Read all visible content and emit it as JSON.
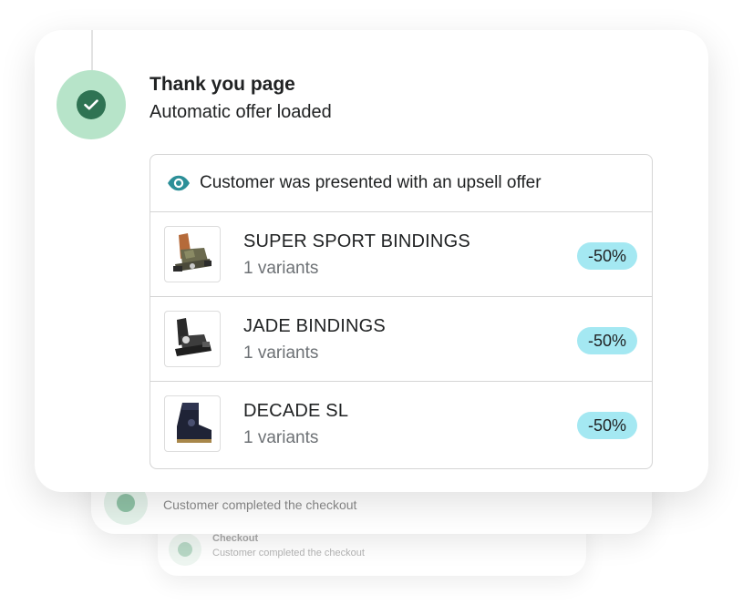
{
  "main_card": {
    "title": "Thank you page",
    "subtitle": "Automatic offer loaded",
    "offer": {
      "header": "Customer was presented with an upsell offer",
      "header_icon": "eye-icon",
      "products": [
        {
          "name": "SUPER SPORT BINDINGS",
          "variants": "1 variants",
          "discount": "-50%",
          "image": "snowboard-binding-camo"
        },
        {
          "name": "JADE BINDINGS",
          "variants": "1 variants",
          "discount": "-50%",
          "image": "snowboard-binding-black"
        },
        {
          "name": "DECADE SL",
          "variants": "1 variants",
          "discount": "-50%",
          "image": "snowboard-boot"
        }
      ]
    }
  },
  "back_card_1": {
    "text": "Customer completed the checkout"
  },
  "back_card_2": {
    "title": "Checkout",
    "text": "Customer completed the checkout"
  },
  "colors": {
    "status_circle_outer": "#b7e4c9",
    "status_circle_inner": "#2f7353",
    "discount_badge": "#a4e8f2",
    "eye_icon": "#2c8f98"
  }
}
